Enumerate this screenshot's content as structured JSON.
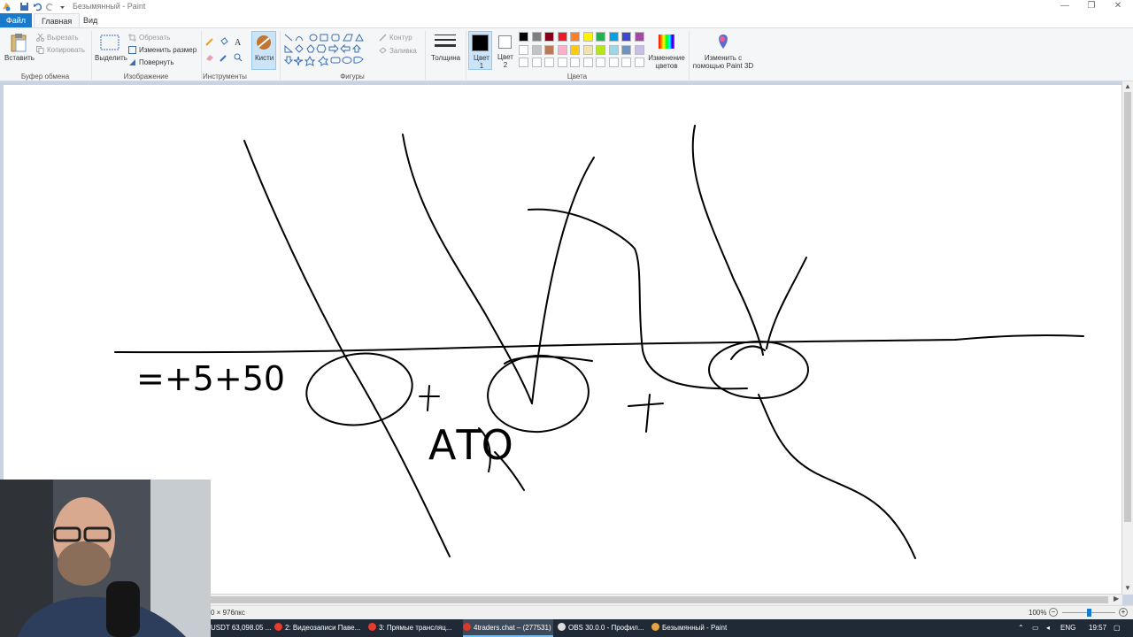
{
  "window": {
    "title": "Безымянный - Paint",
    "minimize": "—",
    "restore": "❐",
    "close": "✕"
  },
  "tabs": {
    "file": "Файл",
    "home": "Главная",
    "view": "Вид"
  },
  "ribbon": {
    "clipboard": {
      "paste": "Вставить",
      "cut": "Вырезать",
      "copy": "Копировать",
      "group": "Буфер обмена"
    },
    "image": {
      "select": "Выделить",
      "crop": "Обрезать",
      "resize": "Изменить размер",
      "rotate": "Повернуть",
      "group": "Изображение"
    },
    "tools": {
      "brushes": "Кисти",
      "group": "Инструменты"
    },
    "shapes": {
      "outline": "Контур",
      "fill": "Заливка",
      "group": "Фигуры"
    },
    "size": "Толщина",
    "colors": {
      "color1": "Цвет 1",
      "color2": "Цвет 2",
      "edit_colors": "Изменение цветов",
      "paint3d": "Изменить с помощью Paint 3D",
      "group": "Цвета",
      "palette_row1": [
        "#000000",
        "#7f7f7f",
        "#880015",
        "#ed1c24",
        "#ff7f27",
        "#fff200",
        "#22b14c",
        "#00a2e8",
        "#3f48cc",
        "#a349a4"
      ],
      "palette_row2": [
        "#ffffff",
        "#c3c3c3",
        "#b97a57",
        "#ffaec9",
        "#ffc90e",
        "#efe4b0",
        "#b5e61d",
        "#99d9ea",
        "#7092be",
        "#c8bfe7"
      ]
    }
  },
  "canvas": {
    "handwriting": "=+5+50",
    "word": "АТО"
  },
  "status": {
    "size": "0 × 976пкс",
    "zoom": "100%"
  },
  "taskbar": {
    "items": [
      "USDT 63,098.05 ...",
      "2: Видеозаписи Паве...",
      "3: Прямые трансляц...",
      "4traders.chat – (277531)",
      "OBS 30.0.0 - Профил...",
      "Безымянный - Paint"
    ],
    "lang": "ENG",
    "time": "19:57"
  }
}
